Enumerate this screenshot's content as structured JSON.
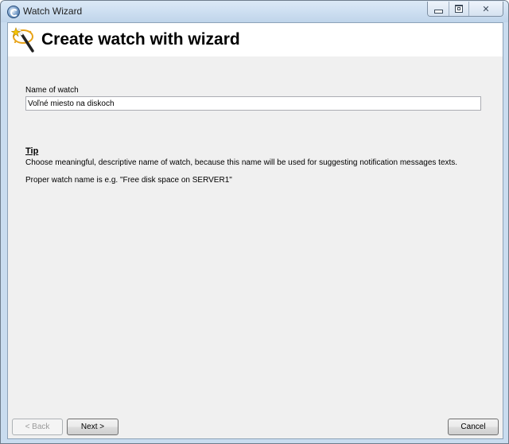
{
  "window": {
    "title": "Watch Wizard",
    "controls": {
      "minimize_icon": "minimize-icon",
      "maximize_icon": "maximize-icon",
      "close_icon": "close-icon",
      "close_glyph": "✕"
    }
  },
  "header": {
    "title": "Create watch with wizard",
    "icon": "wizard-wand-icon"
  },
  "form": {
    "name_label": "Name of watch",
    "name_value": "Voľné miesto na diskoch"
  },
  "tip": {
    "title": "Tip",
    "text": "Choose meaningful, descriptive name of watch, because this name will be used for suggesting notification messages texts.",
    "example": "Proper watch name is e.g. \"Free disk space on SERVER1\""
  },
  "buttons": {
    "back": "< Back",
    "next": "Next >",
    "cancel": "Cancel"
  },
  "colors": {
    "titlebar": "#cfe0f2",
    "client_background": "#f0f0f0",
    "header_background": "#ffffff"
  }
}
